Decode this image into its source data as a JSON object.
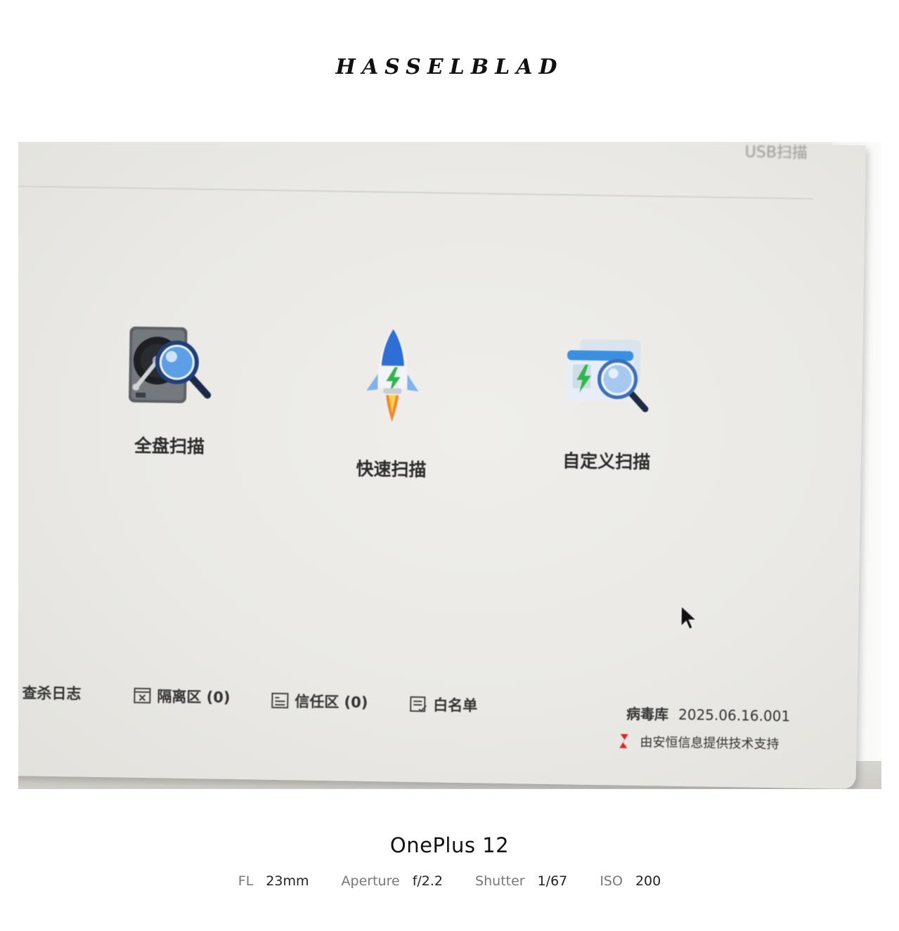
{
  "frame": {
    "brand": "HASSELBLAD",
    "device": "OnePlus 12",
    "exif": [
      {
        "key": "FL",
        "value": "23mm"
      },
      {
        "key": "Aperture",
        "value": "f/2.2"
      },
      {
        "key": "Shutter",
        "value": "1/67"
      },
      {
        "key": "ISO",
        "value": "200"
      }
    ]
  },
  "screen": {
    "top_partial_right": "USB扫描",
    "scan_options": [
      {
        "label": "全盘扫描",
        "icon": "hard-disk-search-icon"
      },
      {
        "label": "快速扫描",
        "icon": "rocket-icon"
      },
      {
        "label": "自定义扫描",
        "icon": "custom-scan-icon"
      }
    ],
    "bottom_bar": {
      "log": "查杀日志",
      "quarantine": "隔离区 (0)",
      "trust": "信任区 (0)",
      "whitelist": "白名单"
    },
    "virus_db_label": "病毒库",
    "virus_db_version": "2025.06.16.001",
    "support_text": "由安恒信息提供技术支持"
  },
  "colors": {
    "accent_green": "#2db84a",
    "accent_blue": "#2e6fd6",
    "vendor_red": "#d8262b"
  }
}
